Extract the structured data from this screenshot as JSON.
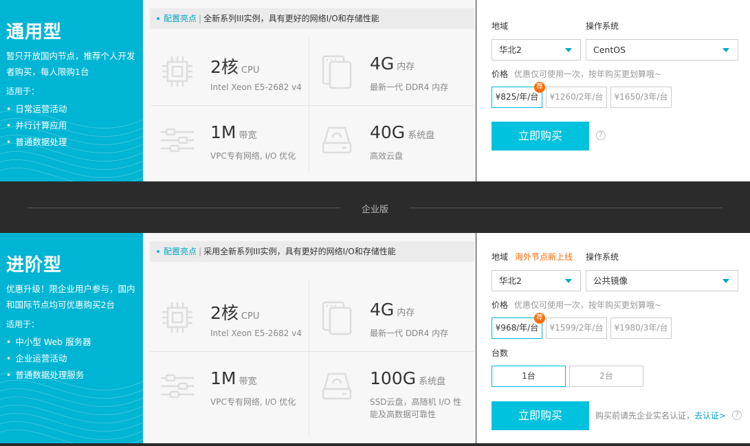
{
  "divider": {
    "label": "企业版"
  },
  "cards": [
    {
      "title": "通用型",
      "desc": "暂只开放国内节点，推荐个人开发者购买，每人限购1台",
      "suit_label": "适用于：",
      "suit_items": [
        "日常运营活动",
        "并行计算应用",
        "普通数据处理"
      ],
      "highlight_tag": "配置亮点",
      "highlight_sep": "|",
      "highlight_text": "全新系列III实例，具有更好的网络I/O和存储性能",
      "specs": [
        {
          "icon": "cpu-icon",
          "value": "2核",
          "unit": "CPU",
          "sub": "Intel Xeon E5-2682 v4"
        },
        {
          "icon": "memory-icon",
          "value": "4G",
          "unit": "内存",
          "sub": "最新一代 DDR4 内存"
        },
        {
          "icon": "network-icon",
          "value": "1M",
          "unit": "带宽",
          "sub": "VPC专有网络, I/O 优化"
        },
        {
          "icon": "disk-icon",
          "value": "40G",
          "unit": "系统盘",
          "sub": "高效云盘"
        }
      ],
      "region_label": "地域",
      "region_value": "华北2",
      "os_label": "操作系统",
      "os_value": "CentOS",
      "price_label": "价格",
      "price_hint": "优惠仅可使用一次，按年购买更划算哦~",
      "prices": [
        "¥825/年/台",
        "¥1260/2年/台",
        "¥1650/3年/台"
      ],
      "badge": "荐",
      "buy_label": "立即购买",
      "help": "?"
    },
    {
      "title": "进阶型",
      "desc": "优惠升级！限企业用户参与，国内和国际节点均可优惠购买2台",
      "suit_label": "适用于：",
      "suit_items": [
        "中小型 Web 服务器",
        "企业运营活动",
        "普通数据处理服务"
      ],
      "highlight_tag": "配置亮点",
      "highlight_sep": "|",
      "highlight_text": "采用全新系列III实例，具有更好的网络I/O和存储性能",
      "specs": [
        {
          "icon": "cpu-icon",
          "value": "2核",
          "unit": "CPU",
          "sub": "Intel Xeon E5-2682 v4"
        },
        {
          "icon": "memory-icon",
          "value": "4G",
          "unit": "内存",
          "sub": "最新一代 DDR4 内存"
        },
        {
          "icon": "network-icon",
          "value": "1M",
          "unit": "带宽",
          "sub": "VPC专有网络, I/O 优化"
        },
        {
          "icon": "disk-icon",
          "value": "100G",
          "unit": "系统盘",
          "sub": "SSD云盘，高随机 I/O 性能及高数据可靠性"
        }
      ],
      "region_label": "地域",
      "region_note": "海外节点新上线",
      "region_value": "华北2",
      "os_label": "操作系统",
      "os_value": "公共镜像",
      "price_label": "价格",
      "price_hint": "优惠仅可使用一次，按年购买更划算哦~",
      "prices": [
        "¥968/年/台",
        "¥1599/2年/台",
        "¥1980/3年/台"
      ],
      "badge": "荐",
      "qty_label": "台数",
      "qty_options": [
        "1台",
        "2台"
      ],
      "buy_label": "立即购买",
      "notice_text": "购买前请先企业实名认证，",
      "notice_link": "去认证>",
      "help": "?"
    }
  ]
}
